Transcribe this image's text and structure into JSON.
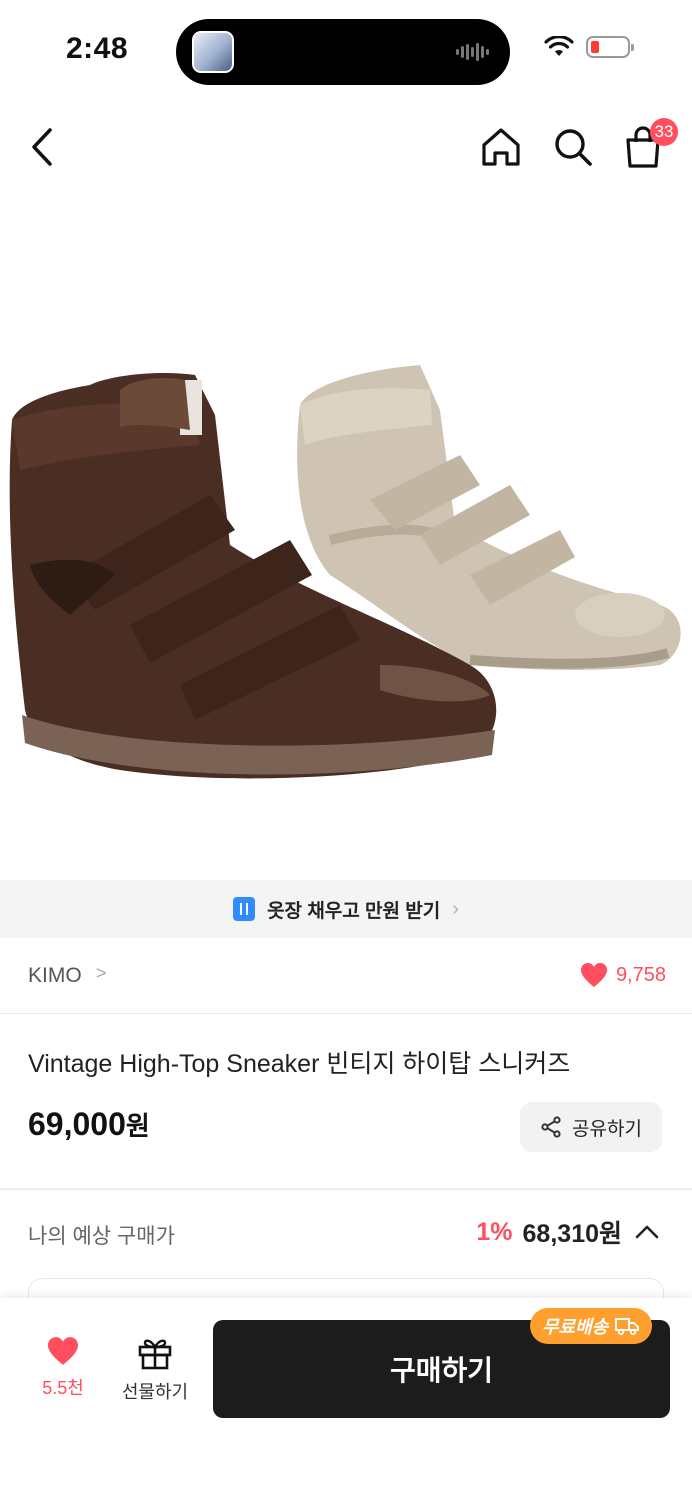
{
  "status_bar": {
    "time": "2:48"
  },
  "header": {
    "cart_count": "33"
  },
  "banner": {
    "text": "옷장 채우고 만원 받기"
  },
  "product": {
    "brand": "KIMO",
    "likes": "9,758",
    "title": "Vintage High-Top Sneaker  빈티지 하이탑 스니커즈",
    "price": "69,000",
    "price_unit": "원",
    "share_label": "공유하기"
  },
  "estimate": {
    "label": "나의 예상 구매가",
    "discount": "1%",
    "price": "68,310원"
  },
  "bottom_bar": {
    "like_count": "5.5천",
    "gift_label": "선물하기",
    "buy_label": "구매하기",
    "free_shipping": "무료배송"
  },
  "colors": {
    "accent_red": "#ff4f5e",
    "buy_button": "#1c1c1c",
    "free_ship_badge": "#ff9f2e",
    "banner_icon": "#2f8cff"
  }
}
